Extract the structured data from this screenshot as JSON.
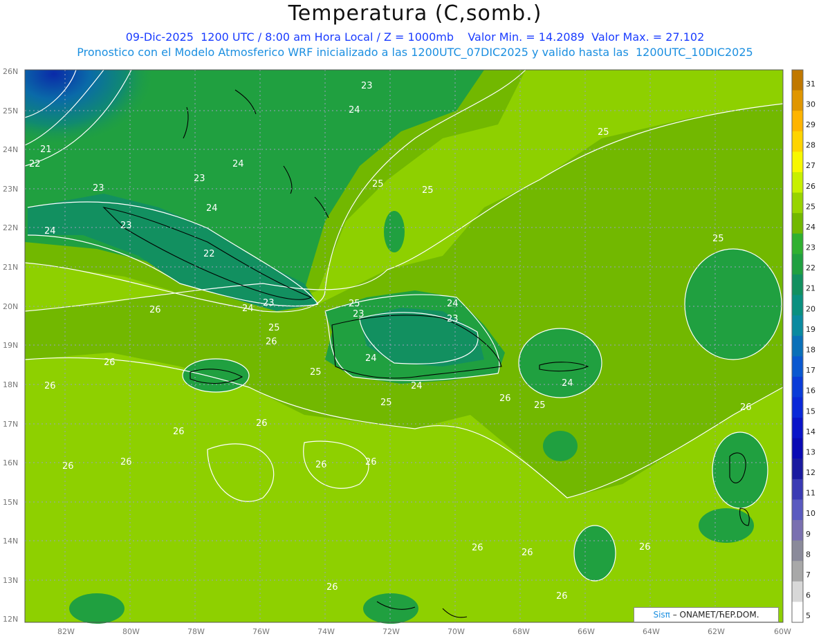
{
  "header": {
    "title": "Temperatura (C,somb.)",
    "subtitle1": "09-Dic-2025  1200 UTC / 8:00 am Hora Local / Z = 1000mb    Valor Min. = 14.2089  Valor Max. = 27.102",
    "subtitle2": "Pronostico con el Modelo Atmosferico WRF inicializado a las 1200UTC_07DIC2025 y valido hasta las  1200UTC_10DIC2025"
  },
  "map": {
    "lat_ticks": [
      "26N",
      "25N",
      "24N",
      "23N",
      "22N",
      "21N",
      "20N",
      "19N",
      "18N",
      "17N",
      "16N",
      "15N",
      "14N",
      "13N",
      "12N"
    ],
    "lon_ticks": [
      "82W",
      "80W",
      "78W",
      "76W",
      "74W",
      "72W",
      "70W",
      "68W",
      "66W",
      "64W",
      "62W",
      "60W"
    ],
    "contour_labels": [
      "23",
      "24",
      "21",
      "22",
      "23",
      "24",
      "24",
      "23",
      "22",
      "24",
      "24",
      "23",
      "25",
      "25",
      "25",
      "24",
      "23",
      "24",
      "23",
      "23",
      "25",
      "26",
      "26",
      "26",
      "26",
      "24",
      "25",
      "25",
      "26",
      "25",
      "26",
      "26",
      "26",
      "26",
      "26",
      "26",
      "26",
      "26",
      "26",
      "26",
      "24",
      "25",
      "25",
      "26",
      "26"
    ]
  },
  "colorbar": {
    "labels": [
      "31",
      "30",
      "29",
      "28",
      "27",
      "26",
      "25",
      "24",
      "23",
      "22",
      "21",
      "20",
      "19",
      "18",
      "17",
      "16",
      "15",
      "14",
      "13",
      "12",
      "11",
      "10",
      "9",
      "8",
      "7",
      "6",
      "5"
    ],
    "colors": [
      "#c07800",
      "#e09600",
      "#ffb400",
      "#ffd400",
      "#f8f800",
      "#c8f000",
      "#98d400",
      "#72b800",
      "#30b030",
      "#20a040",
      "#129060",
      "#0a9080",
      "#0a8aa0",
      "#0a70b8",
      "#0a58d0",
      "#0a3cd8",
      "#0a28d8",
      "#0a14c8",
      "#0a0ab4",
      "#1a1aa0",
      "#3a3ab4",
      "#5a5ac0",
      "#7a70b0",
      "#8a8a9a",
      "#a8a8a8",
      "#d8d8d8",
      "#ffffff"
    ]
  },
  "credit": {
    "brand": "Sisπ",
    "text": "– ONAMET/ЋEP.DOM."
  }
}
